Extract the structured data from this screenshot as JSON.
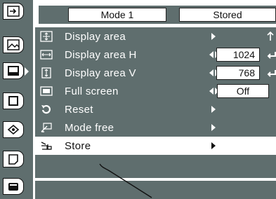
{
  "header": {
    "mode_label": "Mode 1",
    "stored_label": "Stored"
  },
  "tabs": [
    {
      "name": "input-icon"
    },
    {
      "name": "image-adjust-icon"
    },
    {
      "name": "screen-icon",
      "active": true
    },
    {
      "name": "blank-icon"
    },
    {
      "name": "setting-icon"
    },
    {
      "name": "info-icon"
    },
    {
      "name": "menu-icon"
    }
  ],
  "rows": [
    {
      "label": "Display area",
      "control": "arrow"
    },
    {
      "label": "Display area H",
      "control": "value",
      "value": "1024"
    },
    {
      "label": "Display area V",
      "control": "value",
      "value": "768"
    },
    {
      "label": "Full screen",
      "control": "value",
      "value": "Off"
    },
    {
      "label": "Reset",
      "control": "arrow"
    },
    {
      "label": "Mode free",
      "control": "arrow"
    },
    {
      "label": "Store",
      "control": "arrow",
      "selected": true
    }
  ],
  "colors": {
    "menu_bg": "#5f6e6e",
    "highlight": "#ffffff"
  }
}
